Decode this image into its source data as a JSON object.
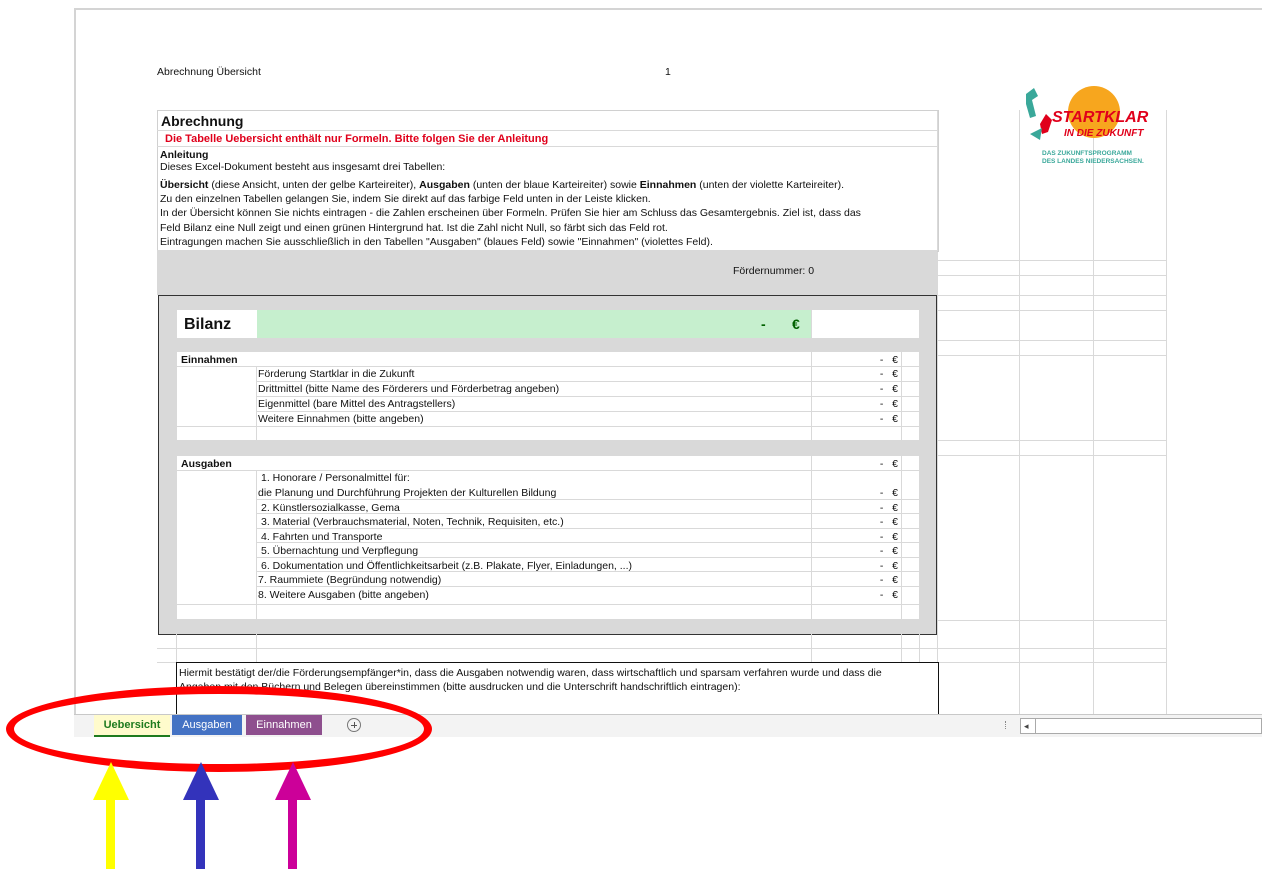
{
  "header": {
    "title": "Abrechnung Übersicht",
    "page_number": "1"
  },
  "logo": {
    "line1": "STARTKLAR",
    "line2": "IN DIE ZUKUNFT",
    "line3": "DAS ZUKUNFTSPROGRAMM",
    "line4": "DES LANDES NIEDERSACHSEN."
  },
  "intro": {
    "heading": "Abrechnung",
    "warning": "Die Tabelle Uebersicht enthält nur Formeln. Bitte folgen Sie der Anleitung",
    "anleitung_label": "Anleitung",
    "line1": "Dieses Excel-Dokument besteht aus insgesamt drei Tabellen:",
    "line2_a": "Übersicht",
    "line2_b": " (diese Ansicht, unten der gelbe Karteireiter), ",
    "line2_c": "Ausgaben",
    "line2_d": " (unten der blaue Karteireiter) sowie ",
    "line2_e": "Einnahmen",
    "line2_f": " (unten der violette Karteireiter).",
    "line3": "Zu den einzelnen Tabellen gelangen Sie, indem Sie direkt auf das farbige Feld unten in der Leiste klicken.",
    "line4": "In der Übersicht können Sie nichts eintragen - die Zahlen erscheinen über Formeln. Prüfen Sie hier am Schluss das Gesamtergebnis. Ziel ist, dass das",
    "line5": "Feld Bilanz eine Null zeigt und einen grünen Hintergrund hat. Ist die Zahl nicht Null, so färbt sich das Feld rot.",
    "line6": "Eintragungen machen Sie ausschließlich in den Tabellen \"Ausgaben\" (blaues Feld) sowie \"Einnahmen\" (violettes Feld).",
    "foerdernummer": "Fördernummer: 0"
  },
  "bilanz": {
    "label": "Bilanz",
    "value": "-",
    "currency": "€"
  },
  "einnahmen": {
    "label": "Einnahmen",
    "total_value": "-",
    "currency": "€",
    "items": [
      {
        "label": "Förderung Startklar in die Zukunft",
        "value": "-",
        "currency": "€"
      },
      {
        "label": "Drittmittel (bitte Name des Förderers und Förderbetrag angeben)",
        "value": "-",
        "currency": "€"
      },
      {
        "label": "Eigenmittel (bare Mittel des Antragstellers)",
        "value": "-",
        "currency": "€"
      },
      {
        "label": "Weitere Einnahmen (bitte angeben)",
        "value": "-",
        "currency": "€"
      }
    ]
  },
  "ausgaben": {
    "label": "Ausgaben",
    "total_value": "-",
    "currency": "€",
    "items": [
      {
        "label": "1. Honorare / Personalmittel für:",
        "value": "",
        "currency": ""
      },
      {
        "label": "die Planung und Durchführung Projekten der Kulturellen Bildung",
        "value": "-",
        "currency": "€"
      },
      {
        "label": "2. Künstlersozialkasse, Gema",
        "value": "-",
        "currency": "€"
      },
      {
        "label": "3. Material (Verbrauchsmaterial, Noten, Technik, Requisiten, etc.)",
        "value": "-",
        "currency": "€"
      },
      {
        "label": "4. Fahrten und Transporte",
        "value": "-",
        "currency": "€"
      },
      {
        "label": "5. Übernachtung und Verpflegung",
        "value": "-",
        "currency": "€"
      },
      {
        "label": "6. Dokumentation und Öffentlichkeitsarbeit (z.B. Plakate, Flyer, Einladungen, ...)",
        "value": "-",
        "currency": "€"
      },
      {
        "label": "7. Raummiete (Begründung notwendig)",
        "value": "-",
        "currency": "€"
      },
      {
        "label": "8. Weitere Ausgaben (bitte angeben)",
        "value": "-",
        "currency": "€"
      }
    ]
  },
  "confirmation": {
    "line1": "Hiermit bestätigt der/die Förderungsempfänger*in, dass die Ausgaben notwendig waren, dass wirtschaftlich und sparsam verfahren wurde und dass die",
    "line2": "Angaben mit den Büchern und Belegen übereinstimmen (bitte ausdrucken und die Unterschrift handschriftlich eintragen):"
  },
  "tabs": [
    {
      "label": "Uebersicht",
      "color": "#fffbcc",
      "text_color": "#1e7a1e"
    },
    {
      "label": "Ausgaben",
      "color": "#4472c4",
      "text_color": "#ffffff"
    },
    {
      "label": "Einnahmen",
      "color": "#8e4f8e",
      "text_color": "#ffffff"
    }
  ],
  "add_sheet_icon": "plus-circle-icon",
  "annotation_colors": {
    "ellipse": "#ff0000",
    "arrow_yellow": "#ffff00",
    "arrow_blue": "#3333bb",
    "arrow_magenta": "#cc0099"
  }
}
